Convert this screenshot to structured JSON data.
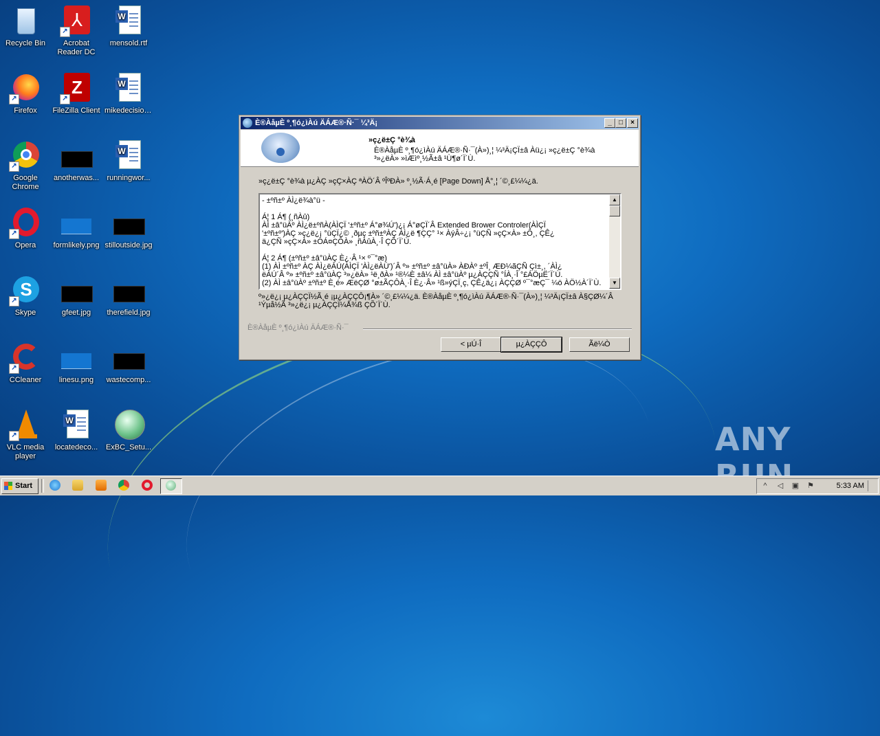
{
  "desktop": {
    "icons": [
      {
        "label": "Recycle Bin"
      },
      {
        "label": "Acrobat Reader DC"
      },
      {
        "label": "mensold.rtf"
      },
      {
        "label": "Firefox"
      },
      {
        "label": "FileZilla Client"
      },
      {
        "label": "mikedecision..."
      },
      {
        "label": "Google Chrome"
      },
      {
        "label": "anotherwas..."
      },
      {
        "label": "runningwor..."
      },
      {
        "label": "Opera"
      },
      {
        "label": "formlikely.png"
      },
      {
        "label": "stilloutside.jpg"
      },
      {
        "label": "Skype"
      },
      {
        "label": "gfeet.jpg"
      },
      {
        "label": "therefield.jpg"
      },
      {
        "label": "CCleaner"
      },
      {
        "label": "linesu.png"
      },
      {
        "label": "wastecomp..."
      },
      {
        "label": "VLC media player"
      },
      {
        "label": "locatedeco..."
      },
      {
        "label": "ExBC_Setu..."
      }
    ]
  },
  "dialog": {
    "title": "È®ÀåµÈ º¸¶ó¿ìÀú ÄÁÆ®·Ñ·¯ ¼³Ä¡",
    "header_title": "»ç¿ë±Ç °è¾à",
    "header_desc": "È®ÀåµÈ º¸¶ó¿ìÀú ÄÁÆ®·Ñ·¯(À»)¸¦ ¼³Ä¡ÇÏ±â Àü¿¡ »ç¿ë±Ç °è¾à ³»¿ëÀ» »ìÆìº¸½Ã±â ¹Ù¶ø´Ï´Ù.",
    "intro": "»ç¿ë±Ç °è¾à µ¿ÀÇ »çÇ×ÀÇ ªÀÖ´Â ºÎºÐÀ» º¸½Ã·Á¸é [Page Down] Å°¸¦ ´©¸£¼¼¿ä.",
    "license_text": "- ±ºñ±º ÀÌ¿ë¾à°ü -\n\nÁ¦ 1 Á¶ (¸ñÀû)\nÀÌ ±â°üÀº ÀÌ¿ë±ºñÀ(ÀÌÇÏ '±ºñ±º Á°ø¾Ú')¿¡ Á°øÇÏ´Â Extended Brower Controler(ÀÌÇÏ\n'±ºñ±º')ÀÇ »ç¿ë¿¡ °üÇÏ¿© ¸ðµç ±ºñ±ºÀÇ ÀÌ¿ë ¶ÇÇ° ¹× ÀýÂ÷¿¡ °üÇÑ »çÇ×À» ±Ô¸, ÇÊ¿\nä¿ÇÑ »çÇ×À» ±ÔÁ¤ÇÔÀ» ¸ñÀûÀ¸·Î ÇÕ´Ï´Ù.\n\nÁ¦ 2 Á¶ (±ºñ±º ±â°üÀÇ È¿·Â ¹× º¯°æ)\n(1) ÀÌ ±ºñ±º ÀÇ ÀÌ¿ëÀÚ(ÀÌÇÏ 'ÀÌ¿ëÀÚ')´Â º» ±ºñ±º ±â°üÀ» ÀÐÀº ±ºÎ¸ ÆÐ¼ãÇÑ Çì±¸, ´ÀÌ¿\nëÀÚ´Â º» ±ºñ±º ±â°üÀÇ ³»¿ëÀ» ¹ë¸ðÀ» ¹®¼­È­ ±â¼ ÀÌ ±â°üÀº µ¿ÀÇÇÑ °ÍÀ¸·Î °£ÁÖµË´Ï´Ù.\n(2) ÀÌ ±â°üÀº ±ºñ±º È­¸é» ÆëÇØ °ø±ÃÇÔÀ¸·Î È¿·Â» ¹ß»ýÇÏ¸ç, ÇÊ¿ä¿¡ ÀÇÇØ º¯°æÇ¯ ¼ö ÀÖ½À´Ï´Ù.",
    "footer_text": "º»¿ë¿¡ µ¿ÀÇÇÏ½Ã¸é ¡µ¿ÀÇÇÔ¡¶À» ´©¸£¼¼¿ä. È®ÀåµÈ º¸¶ó¿ìÀú ÄÁÆ®·Ñ·¯(À»)¸¦ ¼³Ä¡ÇÏ±â À§ÇØ¼­´Â ¹Ýµå½Ã ³»¿ë¿¡ µ¿ÀÇÇÏ¼Å¾ß ÇÕ´Ï´Ù.",
    "brand": "È®ÀåµÈ º¸¶ó¿ìÀú ÄÁÆ®·Ñ·¯",
    "buttons": {
      "back": "< µÚ·Î",
      "agree": "µ¿ÀÇÇÔ",
      "cancel": "Ãë¼Ò"
    }
  },
  "taskbar": {
    "start_label": "Start",
    "clock": "5:33 AM"
  },
  "watermark": "ANY RUN"
}
